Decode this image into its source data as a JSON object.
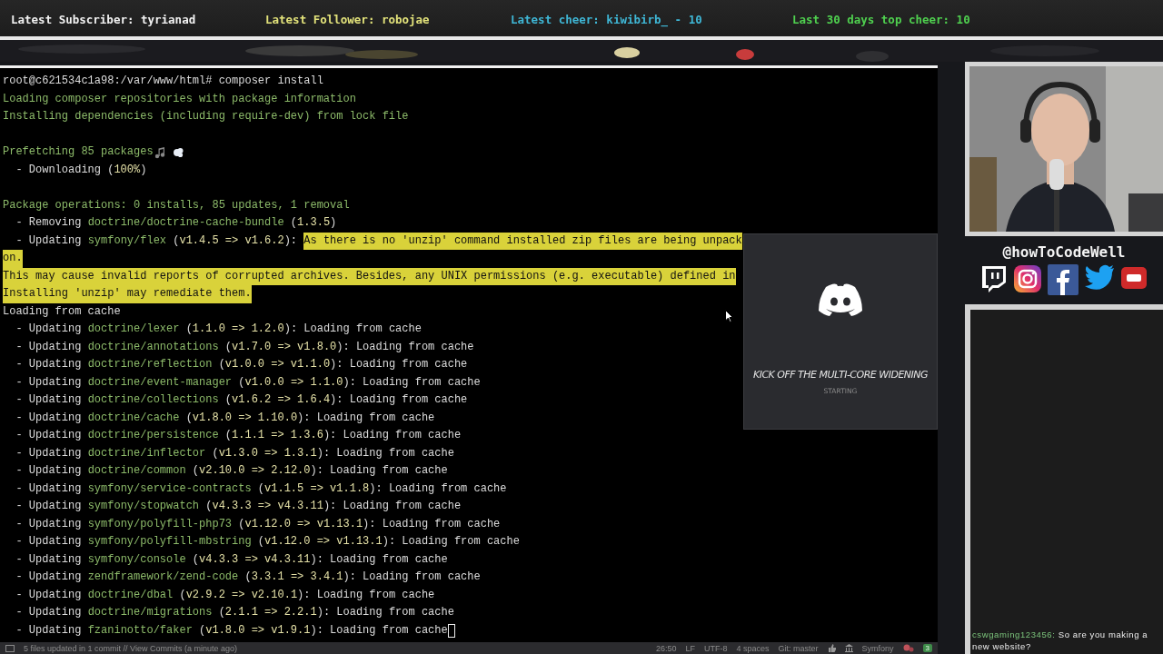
{
  "top_bar": [
    {
      "label": "Latest Subscriber: tyrianad",
      "color": "#f2f2f2"
    },
    {
      "label": "Latest Follower: robojae",
      "color": "#e2e27a"
    },
    {
      "label": "Latest cheer: kiwibirb_ - 10",
      "color": "#3fb7d6"
    },
    {
      "label": "Last 30 days top cheer: 10",
      "color": "#4fd04f"
    }
  ],
  "terminal": {
    "lines": [
      [
        {
          "kind": "text",
          "text": "root@c621534c1a98:/var/www/html# composer install"
        }
      ],
      [
        {
          "kind": "info",
          "text": "Loading composer repositories with package information"
        }
      ],
      [
        {
          "kind": "info",
          "text": "Installing dependencies (including require-dev) from lock file"
        }
      ],
      [
        {
          "kind": "blank"
        }
      ],
      [
        {
          "kind": "info",
          "text": "Prefetching 85 packages"
        },
        {
          "kind": "emoji"
        }
      ],
      [
        {
          "kind": "text",
          "text": "  - Downloading ("
        },
        {
          "kind": "version",
          "text": "100%"
        },
        {
          "kind": "text",
          "text": ")"
        }
      ],
      [
        {
          "kind": "blank"
        }
      ],
      [
        {
          "kind": "info",
          "text": "Package operations: 0 installs, 85 updates, 1 removal"
        }
      ],
      [
        {
          "kind": "text",
          "text": "  - Removing "
        },
        {
          "kind": "package",
          "text": "doctrine/doctrine-cache-bundle"
        },
        {
          "kind": "text",
          "text": " ("
        },
        {
          "kind": "version",
          "text": "1.3.5"
        },
        {
          "kind": "text",
          "text": ")"
        }
      ],
      [
        {
          "kind": "text",
          "text": "  - Updating "
        },
        {
          "kind": "package",
          "text": "symfony/flex"
        },
        {
          "kind": "text",
          "text": " ("
        },
        {
          "kind": "version",
          "text": "v1.4.5 => v1.6.2"
        },
        {
          "kind": "text",
          "text": "): "
        },
        {
          "kind": "highlight",
          "text": "As there is no 'unzip' command installed zip files are being unpack"
        }
      ],
      [
        {
          "kind": "highlight",
          "text": "on."
        }
      ],
      [
        {
          "kind": "highlight",
          "text": "This may cause invalid reports of corrupted archives. Besides, any UNIX permissions (e.g. executable) defined in"
        }
      ],
      [
        {
          "kind": "highlight",
          "text": "Installing 'unzip' may remediate them."
        }
      ],
      [
        {
          "kind": "text",
          "text": "Loading from cache"
        }
      ],
      [
        {
          "kind": "text",
          "text": "  - Updating "
        },
        {
          "kind": "package",
          "text": "doctrine/lexer"
        },
        {
          "kind": "text",
          "text": " ("
        },
        {
          "kind": "version",
          "text": "1.1.0 => 1.2.0"
        },
        {
          "kind": "text",
          "text": "): Loading from cache"
        }
      ],
      [
        {
          "kind": "text",
          "text": "  - Updating "
        },
        {
          "kind": "package",
          "text": "doctrine/annotations"
        },
        {
          "kind": "text",
          "text": " ("
        },
        {
          "kind": "version",
          "text": "v1.7.0 => v1.8.0"
        },
        {
          "kind": "text",
          "text": "): Loading from cache"
        }
      ],
      [
        {
          "kind": "text",
          "text": "  - Updating "
        },
        {
          "kind": "package",
          "text": "doctrine/reflection"
        },
        {
          "kind": "text",
          "text": " ("
        },
        {
          "kind": "version",
          "text": "v1.0.0 => v1.1.0"
        },
        {
          "kind": "text",
          "text": "): Loading from cache"
        }
      ],
      [
        {
          "kind": "text",
          "text": "  - Updating "
        },
        {
          "kind": "package",
          "text": "doctrine/event-manager"
        },
        {
          "kind": "text",
          "text": " ("
        },
        {
          "kind": "version",
          "text": "v1.0.0 => 1.1.0"
        },
        {
          "kind": "text",
          "text": "): Loading from cache"
        }
      ],
      [
        {
          "kind": "text",
          "text": "  - Updating "
        },
        {
          "kind": "package",
          "text": "doctrine/collections"
        },
        {
          "kind": "text",
          "text": " ("
        },
        {
          "kind": "version",
          "text": "v1.6.2 => 1.6.4"
        },
        {
          "kind": "text",
          "text": "): Loading from cache"
        }
      ],
      [
        {
          "kind": "text",
          "text": "  - Updating "
        },
        {
          "kind": "package",
          "text": "doctrine/cache"
        },
        {
          "kind": "text",
          "text": " ("
        },
        {
          "kind": "version",
          "text": "v1.8.0 => 1.10.0"
        },
        {
          "kind": "text",
          "text": "): Loading from cache"
        }
      ],
      [
        {
          "kind": "text",
          "text": "  - Updating "
        },
        {
          "kind": "package",
          "text": "doctrine/persistence"
        },
        {
          "kind": "text",
          "text": " ("
        },
        {
          "kind": "version",
          "text": "1.1.1 => 1.3.6"
        },
        {
          "kind": "text",
          "text": "): Loading from cache"
        }
      ],
      [
        {
          "kind": "text",
          "text": "  - Updating "
        },
        {
          "kind": "package",
          "text": "doctrine/inflector"
        },
        {
          "kind": "text",
          "text": " ("
        },
        {
          "kind": "version",
          "text": "v1.3.0 => 1.3.1"
        },
        {
          "kind": "text",
          "text": "): Loading from cache"
        }
      ],
      [
        {
          "kind": "text",
          "text": "  - Updating "
        },
        {
          "kind": "package",
          "text": "doctrine/common"
        },
        {
          "kind": "text",
          "text": " ("
        },
        {
          "kind": "version",
          "text": "v2.10.0 => 2.12.0"
        },
        {
          "kind": "text",
          "text": "): Loading from cache"
        }
      ],
      [
        {
          "kind": "text",
          "text": "  - Updating "
        },
        {
          "kind": "package",
          "text": "symfony/service-contracts"
        },
        {
          "kind": "text",
          "text": " ("
        },
        {
          "kind": "version",
          "text": "v1.1.5 => v1.1.8"
        },
        {
          "kind": "text",
          "text": "): Loading from cache"
        }
      ],
      [
        {
          "kind": "text",
          "text": "  - Updating "
        },
        {
          "kind": "package",
          "text": "symfony/stopwatch"
        },
        {
          "kind": "text",
          "text": " ("
        },
        {
          "kind": "version",
          "text": "v4.3.3 => v4.3.11"
        },
        {
          "kind": "text",
          "text": "): Loading from cache"
        }
      ],
      [
        {
          "kind": "text",
          "text": "  - Updating "
        },
        {
          "kind": "package",
          "text": "symfony/polyfill-php73"
        },
        {
          "kind": "text",
          "text": " ("
        },
        {
          "kind": "version",
          "text": "v1.12.0 => v1.13.1"
        },
        {
          "kind": "text",
          "text": "): Loading from cache"
        }
      ],
      [
        {
          "kind": "text",
          "text": "  - Updating "
        },
        {
          "kind": "package",
          "text": "symfony/polyfill-mbstring"
        },
        {
          "kind": "text",
          "text": " ("
        },
        {
          "kind": "version",
          "text": "v1.12.0 => v1.13.1"
        },
        {
          "kind": "text",
          "text": "): Loading from cache"
        }
      ],
      [
        {
          "kind": "text",
          "text": "  - Updating "
        },
        {
          "kind": "package",
          "text": "symfony/console"
        },
        {
          "kind": "text",
          "text": " ("
        },
        {
          "kind": "version",
          "text": "v4.3.3 => v4.3.11"
        },
        {
          "kind": "text",
          "text": "): Loading from cache"
        }
      ],
      [
        {
          "kind": "text",
          "text": "  - Updating "
        },
        {
          "kind": "package",
          "text": "zendframework/zend-code"
        },
        {
          "kind": "text",
          "text": " ("
        },
        {
          "kind": "version",
          "text": "3.3.1 => 3.4.1"
        },
        {
          "kind": "text",
          "text": "): Loading from cache"
        }
      ],
      [
        {
          "kind": "text",
          "text": "  - Updating "
        },
        {
          "kind": "package",
          "text": "doctrine/dbal"
        },
        {
          "kind": "text",
          "text": " ("
        },
        {
          "kind": "version",
          "text": "v2.9.2 => v2.10.1"
        },
        {
          "kind": "text",
          "text": "): Loading from cache"
        }
      ],
      [
        {
          "kind": "text",
          "text": "  - Updating "
        },
        {
          "kind": "package",
          "text": "doctrine/migrations"
        },
        {
          "kind": "text",
          "text": " ("
        },
        {
          "kind": "version",
          "text": "2.1.1 => 2.2.1"
        },
        {
          "kind": "text",
          "text": "): Loading from cache"
        }
      ],
      [
        {
          "kind": "text",
          "text": "  - Updating "
        },
        {
          "kind": "package",
          "text": "fzaninotto/faker"
        },
        {
          "kind": "text",
          "text": " ("
        },
        {
          "kind": "version",
          "text": "v1.8.0 => v1.9.1"
        },
        {
          "kind": "text",
          "text": "): Loading from cache"
        },
        {
          "kind": "cursor"
        }
      ]
    ]
  },
  "status_bar": {
    "left": "5 files updated in 1 commit // View Commits (a minute ago)",
    "items": [
      "26:50",
      "LF",
      "UTF-8",
      "4 spaces",
      "Git: master"
    ],
    "framework": "Symfony",
    "badge": "3"
  },
  "discord_overlay": {
    "title": "KICK OFF THE MULTI-CORE WIDENING",
    "status": "STARTING"
  },
  "handle": "@howToCodeWell",
  "chat": [
    {
      "user": "cswgaming123456:",
      "message": "So are you making a new website?"
    }
  ]
}
